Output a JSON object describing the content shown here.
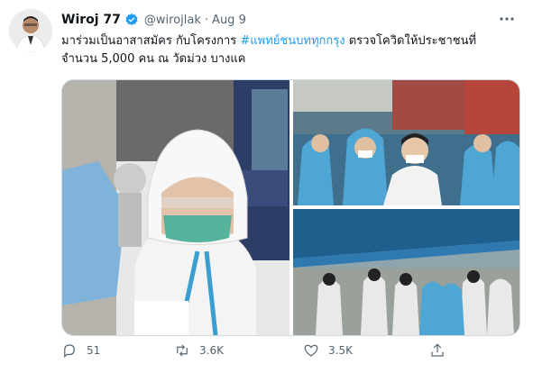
{
  "tweet": {
    "author_name": "Wiroj 77",
    "handle": "@wirojlak",
    "separator": "·",
    "date": "Aug 9",
    "text_part1": "มาร่วมเป็นอาสาสมัคร กับโครงการ ",
    "hashtag": "#แพทย์ชนบททุกกรุง",
    "text_part2": " ตรวจโควิดให้ประชาชนที่",
    "text_line2": "จำนวน 5,000 คน ณ วัดม่วง บางแค"
  },
  "actions": {
    "reply_count": "51",
    "retweet_count": "3.6K",
    "like_count": "3.5K"
  },
  "icons": {
    "verified": "verified-badge-icon",
    "more": "more-options-icon",
    "reply": "reply-icon",
    "retweet": "retweet-icon",
    "like": "like-icon",
    "share": "share-icon"
  },
  "colors": {
    "accent": "#1d9bf0",
    "text": "#0f1419",
    "secondary": "#536471"
  }
}
